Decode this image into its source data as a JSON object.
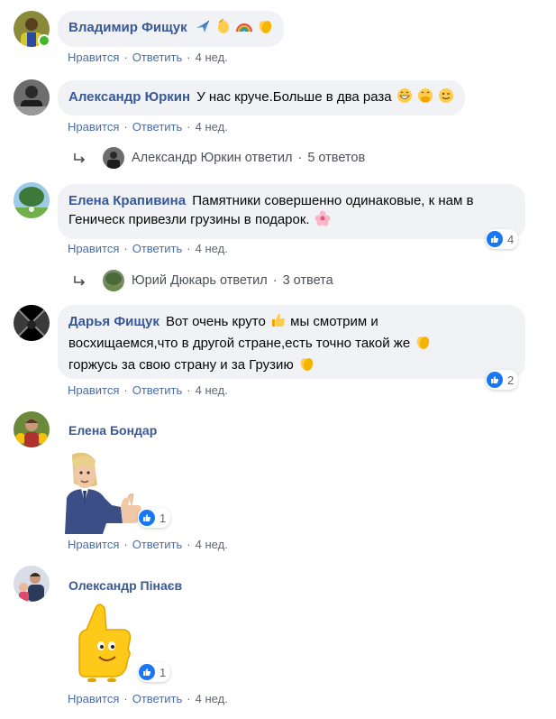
{
  "actions": {
    "like": "Нравится",
    "reply": "Ответить",
    "sep": "·"
  },
  "comments": [
    {
      "author": "Владимир Фищук",
      "text": "",
      "emojis": [
        "airplane-emoji",
        "waving-hand-emoji",
        "rainbow-emoji",
        "clapping-hands-emoji"
      ],
      "time": "4 нед.",
      "online": true
    },
    {
      "author": "Александр Юркин",
      "text": "У нас круче.Больше в два раза",
      "emojis": [
        "grinning-face-emoji",
        "hand-over-mouth-emoji",
        "winking-face-emoji"
      ],
      "time": "4 нед.",
      "reply_summary": {
        "name": "Александр Юркин ответил",
        "count": "5 ответов"
      }
    },
    {
      "author": "Елена Крапивина",
      "text_line1": "Памятники совершенно одинаковые, к нам в",
      "text_line2": "Геническ привезли грузины в подарок.",
      "emojis": [
        "blossom-emoji"
      ],
      "time": "4 нед.",
      "reactions": "4",
      "reply_summary": {
        "name": "Юрий Дюкарь ответил",
        "count": "3 ответа"
      }
    },
    {
      "author": "Дарья Фищук",
      "text_line1": "Вот очень круто",
      "text_line1b": "мы смотрим и",
      "text_line2": "восхищаемся,что в другой стране,есть точно такой же",
      "text_line3": "горжусь за свою страну и за Грузию",
      "time": "4 нед.",
      "reactions": "2"
    },
    {
      "author": "Елена Бондар",
      "sticker": "cartoon-man-thumbs-up-sticker",
      "time": "4 нед.",
      "reactions": "1"
    },
    {
      "author": "Олександр Пінаєв",
      "sticker": "thumbs-up-character-sticker",
      "time": "4 нед.",
      "reactions": "1"
    }
  ],
  "colors": {
    "author": "#385898",
    "link": "#4a6da7",
    "bubble": "#f0f2f5",
    "like": "#1877f2",
    "online": "#42b72a"
  }
}
